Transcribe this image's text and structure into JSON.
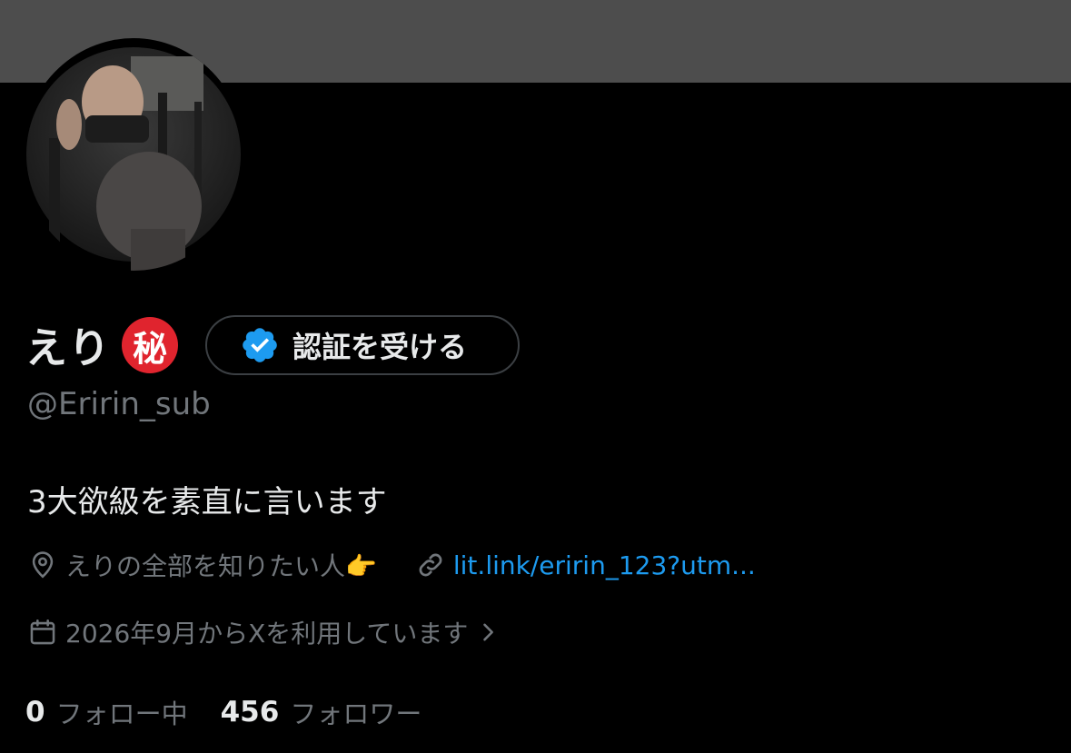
{
  "profile": {
    "display_name": "えり",
    "secret_badge": "秘",
    "verify_button_label": "認証を受ける",
    "handle": "@Eririn_sub",
    "bio": "3大欲級を素直に言います",
    "location": "えりの全部を知りたい人👉",
    "link": "lit.link/eririn_123?utm...",
    "joined": "2026年9月からXを利用しています"
  },
  "stats": {
    "following_count": "0",
    "following_label": "フォロー中",
    "followers_count": "456",
    "followers_label": "フォロワー"
  },
  "colors": {
    "background": "#000000",
    "banner": "#4d4d4d",
    "text_primary": "#e7e9ea",
    "text_secondary": "#71767b",
    "link": "#1d9bf0",
    "badge_red": "#e0242e",
    "verified_blue": "#1d9bf0"
  },
  "icons": {
    "location": "map-pin-icon",
    "link": "link-icon",
    "calendar": "calendar-icon",
    "chevron": "chevron-right-icon",
    "verified": "verified-check-icon"
  }
}
